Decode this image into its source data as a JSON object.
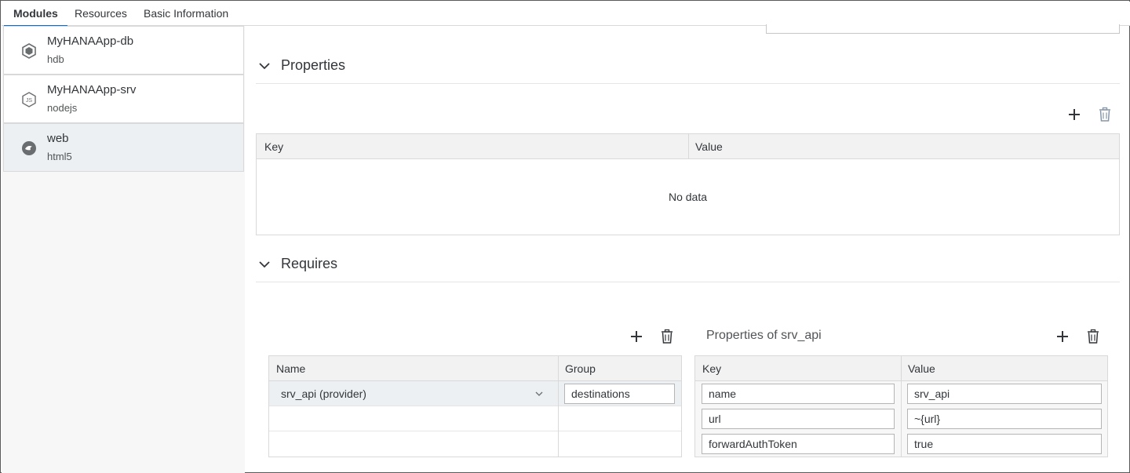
{
  "tabs": [
    {
      "label": "Modules",
      "active": true
    },
    {
      "label": "Resources",
      "active": false
    },
    {
      "label": "Basic Information",
      "active": false
    }
  ],
  "modules": [
    {
      "name": "MyHANAApp-db",
      "type": "hdb",
      "icon": "hdb-cube-icon",
      "selected": false
    },
    {
      "name": "MyHANAApp-srv",
      "type": "nodejs",
      "icon": "nodejs-icon",
      "selected": false
    },
    {
      "name": "web",
      "type": "html5",
      "icon": "html5-globe-icon",
      "selected": true
    }
  ],
  "properties": {
    "title": "Properties",
    "columns": [
      "Key",
      "Value"
    ],
    "empty_text": "No data"
  },
  "requires": {
    "title": "Requires",
    "columns": [
      "Name",
      "Group"
    ],
    "rows": [
      {
        "name": "srv_api (provider)",
        "group": "destinations"
      },
      {
        "name": "",
        "group": ""
      },
      {
        "name": "",
        "group": ""
      }
    ]
  },
  "requires_properties": {
    "title": "Properties of srv_api",
    "columns": [
      "Key",
      "Value"
    ],
    "rows": [
      {
        "key": "name",
        "value": "srv_api"
      },
      {
        "key": "url",
        "value": "~{url}"
      },
      {
        "key": "forwardAuthToken",
        "value": "true"
      }
    ]
  },
  "colors": {
    "accent": "#0a6ed1",
    "icon": "#32363a",
    "delete_icon": "#8696a9"
  }
}
